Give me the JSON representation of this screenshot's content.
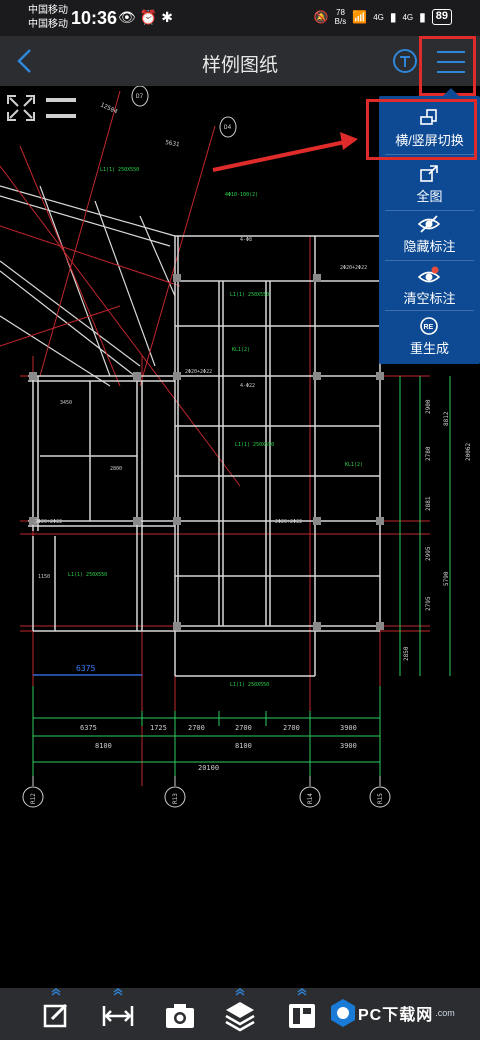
{
  "status_bar": {
    "carrier_1": "中国移动",
    "carrier_2": "中国移动",
    "time": "10:36",
    "net_speed_value": "78",
    "net_speed_unit": "B/s",
    "signal_1": "4G",
    "signal_2": "4G",
    "battery": "89"
  },
  "header": {
    "title": "样例图纸"
  },
  "menu": {
    "items": [
      {
        "label": "横/竖屏切换",
        "icon": "rotate-screen-icon"
      },
      {
        "label": "全图",
        "icon": "full-view-icon"
      },
      {
        "label": "隐藏标注",
        "icon": "hide-eye-icon"
      },
      {
        "label": "清空标注",
        "icon": "clear-eye-icon"
      },
      {
        "label": "重生成",
        "icon": "regenerate-icon"
      }
    ]
  },
  "drawing": {
    "dims_bottom_row1": [
      "6375",
      "1725",
      "2700",
      "2700",
      "2700",
      "3900"
    ],
    "dims_bottom_row2": [
      "8100",
      "8100",
      "3900"
    ],
    "dim_total": "20100",
    "dim_blue": "6375",
    "dims_right": [
      "2900",
      "2780",
      "2881",
      "2995",
      "2795",
      "2850"
    ],
    "dims_right_outer": [
      "8812",
      "20062",
      "5790"
    ],
    "axis_labels": [
      "R12",
      "R13",
      "R14",
      "R15",
      "D7",
      "D4"
    ],
    "top_dims": [
      "12504",
      "5631"
    ],
    "misc_labels": [
      "3450",
      "2800",
      "1150",
      "4-Φ8",
      "4-Φ22",
      "2Φ20+2Φ22",
      "L1(1) 250X550",
      "KL1(2)",
      "4Φ10-100(2)"
    ],
    "colors": {
      "grid": "#c0272d",
      "wall": "#d8d8d8",
      "annot": "#2bd44c",
      "dim": "#2ecc60",
      "blue": "#3c7cff",
      "axis": "#cfcfcf"
    }
  },
  "toolbar": {
    "items": [
      "edit-icon",
      "measure-icon",
      "camera-icon",
      "layers-icon",
      "layout-icon"
    ]
  },
  "watermark": {
    "text": "PC下载网",
    "sub": ".com"
  }
}
